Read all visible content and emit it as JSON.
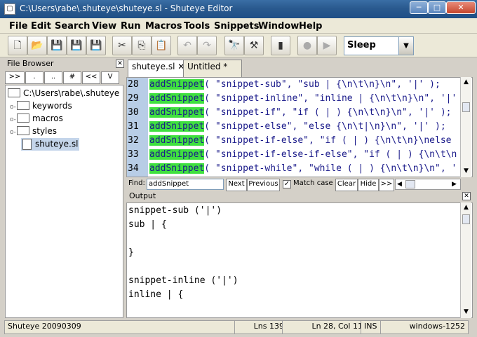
{
  "window": {
    "title": "C:\\Users\\rabe\\.shuteye\\shuteye.sl - Shuteye Editor"
  },
  "menu": [
    "File",
    "Edit",
    "Search",
    "View",
    "Run",
    "Macros",
    "Tools",
    "Snippets",
    "Window",
    "Help"
  ],
  "toolbar": {
    "mode_select": "Sleep"
  },
  "file_browser": {
    "title": "File Browser",
    "buttons": [
      ">>",
      ".",
      "..",
      "#",
      "<<",
      "V"
    ],
    "root": "C:\\Users\\rabe\\.shuteye",
    "items": [
      "keywords",
      "macros",
      "styles",
      "shuteye.sl"
    ]
  },
  "tabs": [
    "shuteye.sl",
    "Untitled *"
  ],
  "editor": {
    "lines": [
      {
        "num": "28",
        "fn": "addSnippet",
        "rest": "( \"snippet-sub\", \"sub | {\\n\\t\\n}\\n\", '|' );"
      },
      {
        "num": "29",
        "fn": "addSnippet",
        "rest": "( \"snippet-inline\", \"inline | {\\n\\t\\n}\\n\", '|'"
      },
      {
        "num": "30",
        "fn": "addSnippet",
        "rest": "( \"snippet-if\", \"if ( | ) {\\n\\t\\n}\\n\", '|' );"
      },
      {
        "num": "31",
        "fn": "addSnippet",
        "rest": "( \"snippet-else\", \"else {\\n\\t|\\n}\\n\", '|' );"
      },
      {
        "num": "32",
        "fn": "addSnippet",
        "rest": "( \"snippet-if-else\", \"if ( | ) {\\n\\t\\n}\\nelse"
      },
      {
        "num": "33",
        "fn": "addSnippet",
        "rest": "( \"snippet-if-else-if-else\", \"if ( | ) {\\n\\t\\n"
      },
      {
        "num": "34",
        "fn": "addSnippet",
        "rest": "( \"snippet-while\", \"while ( | ) {\\n\\t\\n}\\n\", '"
      }
    ]
  },
  "find": {
    "label": "Find:",
    "value": "addSnippet",
    "next": "Next",
    "previous": "Previous",
    "match_case": "Match case",
    "clear": "Clear",
    "hide": "Hide",
    "more": ">>"
  },
  "output": {
    "title": "Output",
    "lines": [
      "snippet-sub ('|')",
      "sub | {",
      "",
      "}",
      "",
      "snippet-inline ('|')",
      "inline | {"
    ]
  },
  "status": {
    "version": "Shuteye 20090309",
    "lines": "Lns 139",
    "position": "Ln 28, Col 11",
    "mode": "INS",
    "encoding": "windows-1252"
  }
}
